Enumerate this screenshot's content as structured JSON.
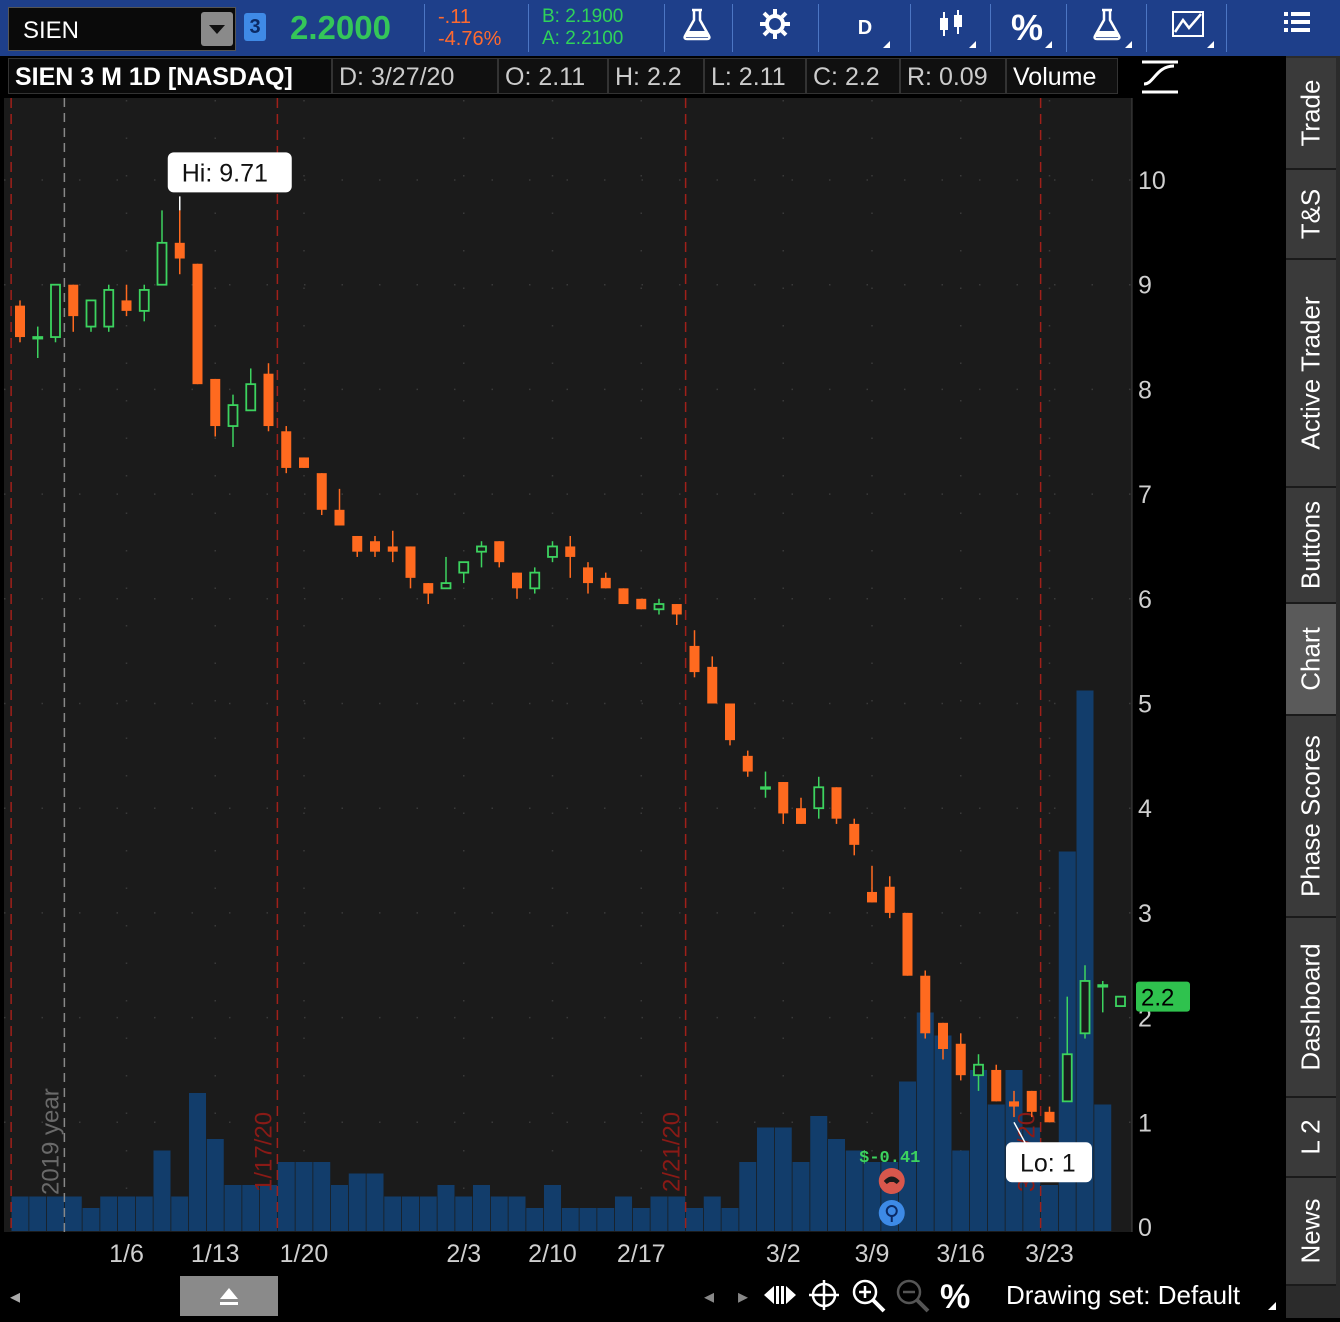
{
  "toolbar": {
    "symbol": "SIEN",
    "link_group": "3",
    "last_price": "2.2000",
    "net_change": "-.11",
    "net_change_pct": "-4.76%",
    "bid": "B: 2.1900",
    "ask": "A: 2.2100",
    "aggregation": "D",
    "percent_glyph": "%",
    "icons": [
      "flask-icon",
      "gear-icon",
      "aggregation-menu",
      "candlestick-style-icon",
      "percent-icon",
      "studies-flask-icon",
      "drawings-icon",
      "menu-icon"
    ]
  },
  "header": {
    "title": "SIEN 3 M 1D [NASDAQ]",
    "date": "D: 3/27/20",
    "open": "O: 2.11",
    "high": "H: 2.2",
    "low": "L: 2.11",
    "close": "C: 2.2",
    "range": "R: 0.09",
    "volume_label": "Volume"
  },
  "sidebar": {
    "tabs": [
      {
        "label": "Trade",
        "active": false
      },
      {
        "label": "T&S",
        "active": false
      },
      {
        "label": "Active Trader",
        "active": false
      },
      {
        "label": "Buttons",
        "active": false
      },
      {
        "label": "Chart",
        "active": true
      },
      {
        "label": "Phase Scores",
        "active": false
      },
      {
        "label": "Dashboard",
        "active": false
      },
      {
        "label": "L 2",
        "active": false
      },
      {
        "label": "News",
        "active": false
      }
    ]
  },
  "bottombar": {
    "drawing_set": "Drawing set: Default",
    "percent_glyph": "%"
  },
  "colors": {
    "up": "#3cd35f",
    "down": "#ff6a1f",
    "volume": "#123d6b",
    "event_line": "#a0201a",
    "year_line": "#888888",
    "price_label_bg": "#2fc24e",
    "eps_text": "#3cd35f"
  },
  "chart_data": {
    "type": "candlestick",
    "title": "SIEN 3 M 1D [NASDAQ]",
    "ylim": [
      0,
      10.9
    ],
    "y_ticks": [
      0,
      1,
      2,
      3,
      4,
      5,
      6,
      7,
      8,
      9,
      10
    ],
    "x_tick_labels": [
      {
        "label": "1/6",
        "index": 6
      },
      {
        "label": "1/13",
        "index": 11
      },
      {
        "label": "1/20",
        "index": 16
      },
      {
        "label": "2/3",
        "index": 25
      },
      {
        "label": "2/10",
        "index": 30
      },
      {
        "label": "2/17",
        "index": 35
      },
      {
        "label": "3/2",
        "index": 43
      },
      {
        "label": "3/9",
        "index": 48
      },
      {
        "label": "3/16",
        "index": 53
      },
      {
        "label": "3/23",
        "index": 58
      }
    ],
    "last_price_label": "2.2",
    "annotations": {
      "high": {
        "text": "Hi: 9.71",
        "index": 9,
        "value": 9.71
      },
      "low": {
        "text": "Lo: 1",
        "index": 56,
        "value": 1.0
      },
      "eps": {
        "text": "$-0.41",
        "index": 49
      }
    },
    "vertical_markers": [
      {
        "label": "2019 year",
        "index": 2.5,
        "kind": "year"
      },
      {
        "label": "",
        "index": -0.5,
        "kind": "event"
      },
      {
        "label": "1/17/20",
        "index": 14.5,
        "kind": "event"
      },
      {
        "label": "2/21/20",
        "index": 37.5,
        "kind": "event"
      },
      {
        "label": "3/20/20",
        "index": 57.5,
        "kind": "event"
      }
    ],
    "candles": [
      {
        "o": 8.8,
        "h": 8.85,
        "l": 8.45,
        "c": 8.5
      },
      {
        "o": 8.5,
        "h": 8.6,
        "l": 8.3,
        "c": 8.5
      },
      {
        "o": 8.5,
        "h": 9.0,
        "l": 8.45,
        "c": 9.0
      },
      {
        "o": 9.0,
        "h": 9.0,
        "l": 8.55,
        "c": 8.7
      },
      {
        "o": 8.6,
        "h": 8.85,
        "l": 8.55,
        "c": 8.85
      },
      {
        "o": 8.6,
        "h": 9.0,
        "l": 8.55,
        "c": 8.95
      },
      {
        "o": 8.85,
        "h": 9.0,
        "l": 8.7,
        "c": 8.75
      },
      {
        "o": 8.75,
        "h": 9.0,
        "l": 8.65,
        "c": 8.95
      },
      {
        "o": 9.0,
        "h": 9.71,
        "l": 9.0,
        "c": 9.4
      },
      {
        "o": 9.4,
        "h": 9.71,
        "l": 9.1,
        "c": 9.25
      },
      {
        "o": 9.2,
        "h": 9.2,
        "l": 8.05,
        "c": 8.05
      },
      {
        "o": 8.1,
        "h": 8.1,
        "l": 7.55,
        "c": 7.65
      },
      {
        "o": 7.65,
        "h": 7.95,
        "l": 7.45,
        "c": 7.85
      },
      {
        "o": 7.8,
        "h": 8.2,
        "l": 7.8,
        "c": 8.05
      },
      {
        "o": 8.15,
        "h": 8.25,
        "l": 7.6,
        "c": 7.65
      },
      {
        "o": 7.6,
        "h": 7.65,
        "l": 7.2,
        "c": 7.25
      },
      {
        "o": 7.35,
        "h": 7.35,
        "l": 7.25,
        "c": 7.25
      },
      {
        "o": 7.2,
        "h": 7.2,
        "l": 6.8,
        "c": 6.85
      },
      {
        "o": 6.85,
        "h": 7.05,
        "l": 6.75,
        "c": 6.7
      },
      {
        "o": 6.6,
        "h": 6.6,
        "l": 6.4,
        "c": 6.45
      },
      {
        "o": 6.55,
        "h": 6.6,
        "l": 6.4,
        "c": 6.45
      },
      {
        "o": 6.5,
        "h": 6.65,
        "l": 6.35,
        "c": 6.45
      },
      {
        "o": 6.5,
        "h": 6.5,
        "l": 6.1,
        "c": 6.2
      },
      {
        "o": 6.15,
        "h": 6.15,
        "l": 5.95,
        "c": 6.05
      },
      {
        "o": 6.1,
        "h": 6.4,
        "l": 6.1,
        "c": 6.15
      },
      {
        "o": 6.25,
        "h": 6.35,
        "l": 6.15,
        "c": 6.35
      },
      {
        "o": 6.45,
        "h": 6.55,
        "l": 6.3,
        "c": 6.5
      },
      {
        "o": 6.55,
        "h": 6.55,
        "l": 6.3,
        "c": 6.35
      },
      {
        "o": 6.25,
        "h": 6.25,
        "l": 6.0,
        "c": 6.1
      },
      {
        "o": 6.1,
        "h": 6.3,
        "l": 6.05,
        "c": 6.25
      },
      {
        "o": 6.4,
        "h": 6.55,
        "l": 6.35,
        "c": 6.5
      },
      {
        "o": 6.5,
        "h": 6.6,
        "l": 6.2,
        "c": 6.4
      },
      {
        "o": 6.3,
        "h": 6.35,
        "l": 6.05,
        "c": 6.15
      },
      {
        "o": 6.2,
        "h": 6.25,
        "l": 6.1,
        "c": 6.1
      },
      {
        "o": 6.1,
        "h": 6.1,
        "l": 5.95,
        "c": 5.95
      },
      {
        "o": 6.0,
        "h": 6.0,
        "l": 5.9,
        "c": 5.9
      },
      {
        "o": 5.9,
        "h": 6.0,
        "l": 5.85,
        "c": 5.95
      },
      {
        "o": 5.95,
        "h": 5.95,
        "l": 5.75,
        "c": 5.85
      },
      {
        "o": 5.55,
        "h": 5.7,
        "l": 5.25,
        "c": 5.3
      },
      {
        "o": 5.35,
        "h": 5.45,
        "l": 5.0,
        "c": 5.0
      },
      {
        "o": 5.0,
        "h": 5.0,
        "l": 4.6,
        "c": 4.65
      },
      {
        "o": 4.5,
        "h": 4.55,
        "l": 4.3,
        "c": 4.35
      },
      {
        "o": 4.2,
        "h": 4.35,
        "l": 4.1,
        "c": 4.2
      },
      {
        "o": 4.25,
        "h": 4.25,
        "l": 3.85,
        "c": 3.95
      },
      {
        "o": 4.0,
        "h": 4.1,
        "l": 3.85,
        "c": 3.85
      },
      {
        "o": 4.0,
        "h": 4.3,
        "l": 3.9,
        "c": 4.2
      },
      {
        "o": 4.2,
        "h": 4.2,
        "l": 3.85,
        "c": 3.9
      },
      {
        "o": 3.85,
        "h": 3.9,
        "l": 3.55,
        "c": 3.65
      },
      {
        "o": 3.2,
        "h": 3.45,
        "l": 3.1,
        "c": 3.1
      },
      {
        "o": 3.25,
        "h": 3.35,
        "l": 2.95,
        "c": 3.0
      },
      {
        "o": 3.0,
        "h": 3.0,
        "l": 2.4,
        "c": 2.4
      },
      {
        "o": 2.4,
        "h": 2.45,
        "l": 1.8,
        "c": 1.85
      },
      {
        "o": 1.95,
        "h": 1.95,
        "l": 1.6,
        "c": 1.7
      },
      {
        "o": 1.75,
        "h": 1.85,
        "l": 1.4,
        "c": 1.45
      },
      {
        "o": 1.45,
        "h": 1.65,
        "l": 1.3,
        "c": 1.55
      },
      {
        "o": 1.5,
        "h": 1.55,
        "l": 1.2,
        "c": 1.2
      },
      {
        "o": 1.2,
        "h": 1.3,
        "l": 1.05,
        "c": 1.15
      },
      {
        "o": 1.3,
        "h": 1.3,
        "l": 1.05,
        "c": 1.1
      },
      {
        "o": 1.1,
        "h": 1.15,
        "l": 1.0,
        "c": 1.0
      },
      {
        "o": 1.2,
        "h": 2.2,
        "l": 1.2,
        "c": 1.65
      },
      {
        "o": 1.85,
        "h": 2.5,
        "l": 1.8,
        "c": 2.35
      },
      {
        "o": 2.3,
        "h": 2.35,
        "l": 2.05,
        "c": 2.31
      },
      {
        "o": 2.11,
        "h": 2.2,
        "l": 2.11,
        "c": 2.2
      }
    ],
    "volume_bar_heights_fraction": [
      0.03,
      0.03,
      0.03,
      0.03,
      0.02,
      0.03,
      0.03,
      0.03,
      0.07,
      0.03,
      0.12,
      0.08,
      0.04,
      0.04,
      0.04,
      0.06,
      0.06,
      0.06,
      0.04,
      0.05,
      0.05,
      0.03,
      0.03,
      0.03,
      0.04,
      0.03,
      0.04,
      0.03,
      0.03,
      0.02,
      0.04,
      0.02,
      0.02,
      0.02,
      0.03,
      0.02,
      0.03,
      0.03,
      0.02,
      0.03,
      0.02,
      0.06,
      0.09,
      0.09,
      0.06,
      0.1,
      0.08,
      0.07,
      0.06,
      0.06,
      0.13,
      0.19,
      0.17,
      0.07,
      0.14,
      0.11,
      0.14,
      0.09,
      0.04,
      0.33,
      0.47,
      0.11,
      0.0
    ]
  }
}
